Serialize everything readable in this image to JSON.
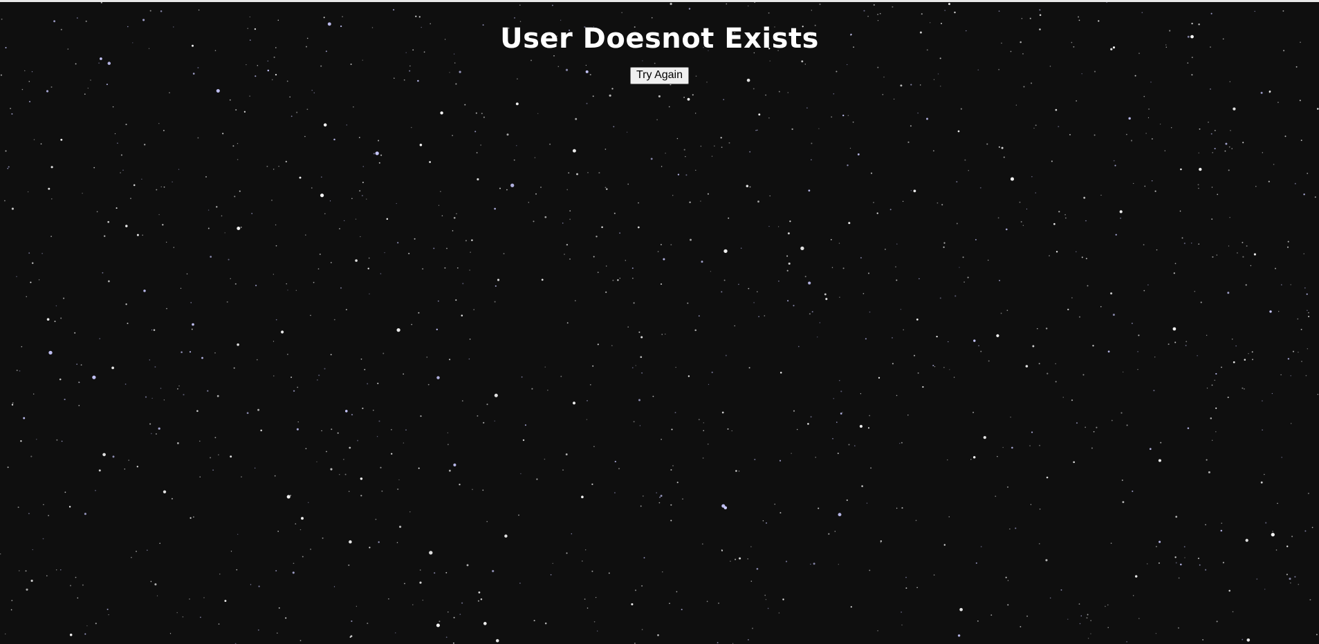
{
  "page": {
    "title": "User Doesnot Exists",
    "try_again_label": "Try Again"
  },
  "colors": {
    "background": "#0f0f0f",
    "title_text": "#ffffff",
    "button_background": "#efefef",
    "button_border": "#767676"
  }
}
